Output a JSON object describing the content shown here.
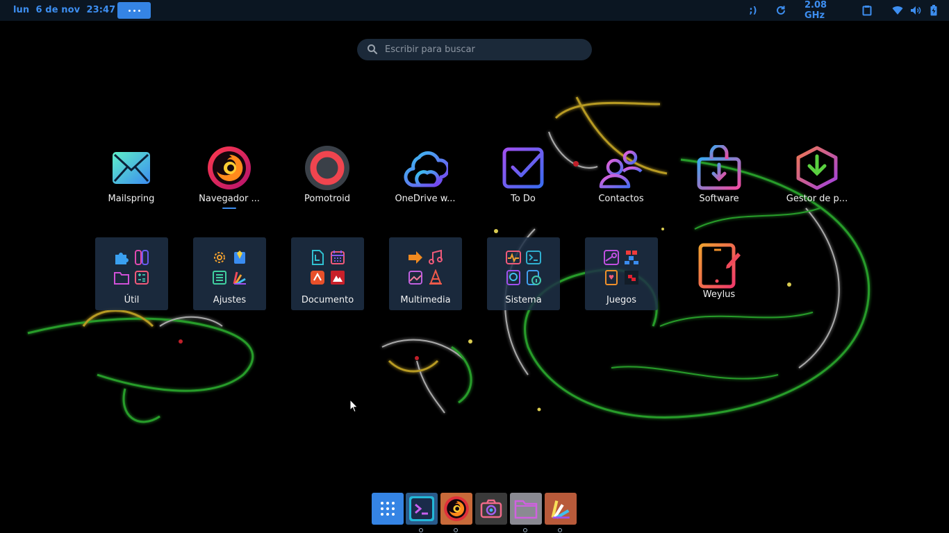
{
  "top_panel": {
    "clock": "lun  6 de nov  23:47",
    "indicator_text": ";)",
    "cpu_freq": "2.08 GHz",
    "icons": [
      "refresh-icon",
      "clipboard-icon",
      "wifi-icon",
      "volume-icon",
      "battery-icon"
    ]
  },
  "search": {
    "placeholder": "Escribir para buscar",
    "value": ""
  },
  "apps": [
    {
      "label": "Mailspring",
      "icon": "mail-icon"
    },
    {
      "label": "Navegador ...",
      "icon": "firefox-icon",
      "running": true
    },
    {
      "label": "Pomotroid",
      "icon": "pomotroid-icon"
    },
    {
      "label": "OneDrive w...",
      "icon": "cloud-icon"
    },
    {
      "label": "To Do",
      "icon": "todo-check-icon"
    },
    {
      "label": "Contactos",
      "icon": "contacts-icon"
    },
    {
      "label": "Software",
      "icon": "software-bag-icon"
    },
    {
      "label": "Gestor de p...",
      "icon": "package-manager-icon"
    }
  ],
  "folders": [
    {
      "label": "Útil"
    },
    {
      "label": "Ajustes"
    },
    {
      "label": "Documento"
    },
    {
      "label": "Multimedia"
    },
    {
      "label": "Sistema"
    },
    {
      "label": "Juegos"
    }
  ],
  "extra_apps": [
    {
      "label": "Weylus",
      "icon": "tablet-pen-icon"
    }
  ],
  "dock": {
    "items": [
      "app-grid-icon",
      "terminal-icon",
      "firefox-icon",
      "screenshot-camera-icon",
      "files-folder-icon",
      "color-palette-icon"
    ],
    "running": [
      "terminal-icon",
      "firefox-icon",
      "files-folder-icon",
      "color-palette-icon"
    ]
  },
  "colors": {
    "accent": "#3584e4",
    "panel_text": "#3d8ef0",
    "panel_bg": "#0b1622"
  }
}
